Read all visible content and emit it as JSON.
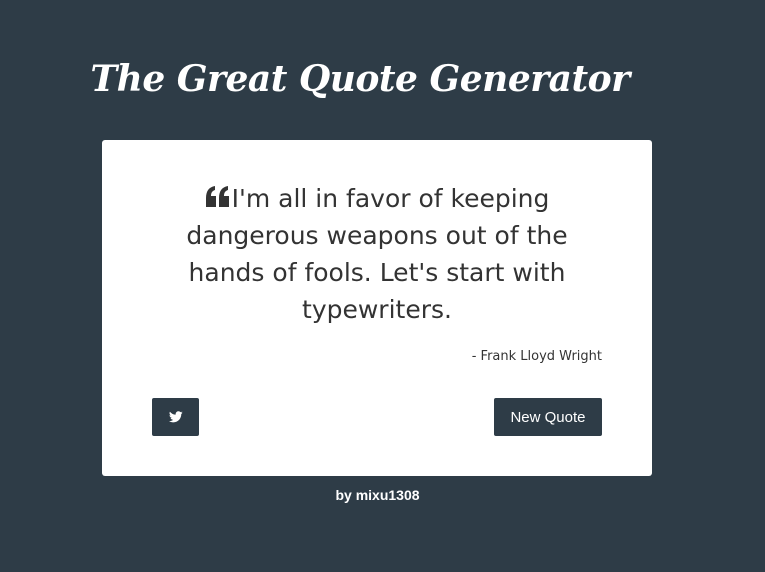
{
  "header": {
    "title": "The Great Quote Generator"
  },
  "quote": {
    "text": "I'm all in favor of keeping dangerous weapons out of the hands of fools. Let's start with typewriters.",
    "author": "- Frank Lloyd Wright",
    "icon": "quote-left-icon"
  },
  "actions": {
    "tweet_icon": "twitter-icon",
    "new_quote_label": "New Quote"
  },
  "footer": {
    "credit": "by mixu1308"
  },
  "colors": {
    "background": "#2e3c47",
    "card": "#ffffff",
    "text": "#333333",
    "button": "#2e3c47"
  }
}
